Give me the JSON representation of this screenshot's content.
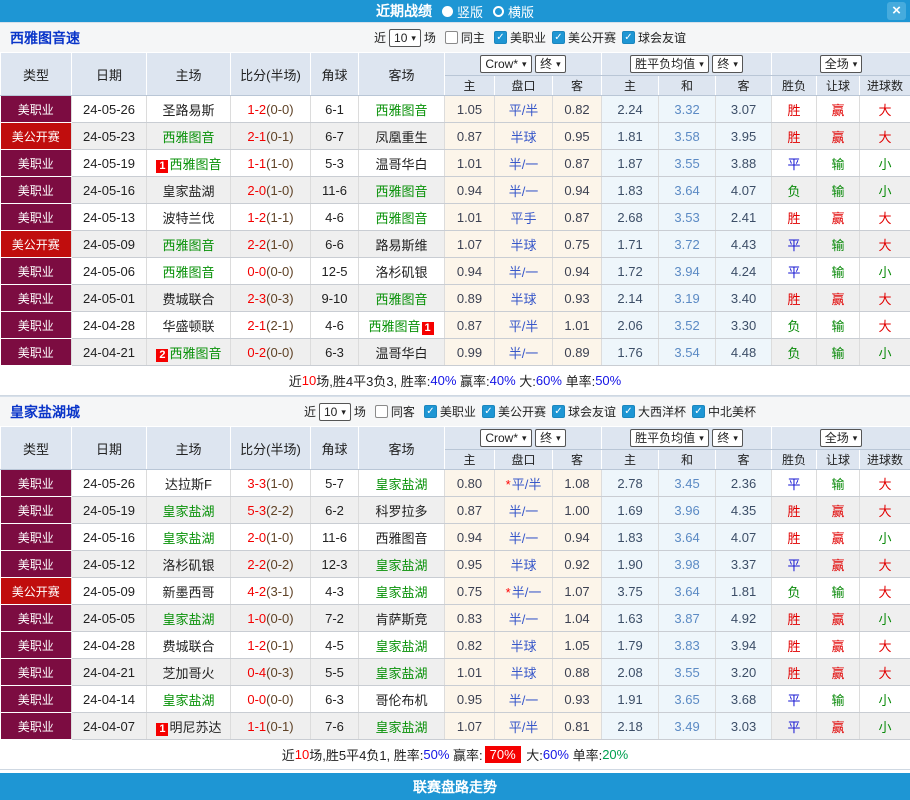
{
  "titlebar": {
    "title": "近期战绩",
    "vertical_label": "竖版",
    "horizontal_label": "横版",
    "close_glyph": "×"
  },
  "footer": {
    "label": "联赛盘路走势"
  },
  "icons": {
    "check": "✓",
    "caret": "▾",
    "star": "*"
  },
  "headers": {
    "type": "类型",
    "date": "日期",
    "home": "主场",
    "score": "比分(半场)",
    "corner": "角球",
    "away": "客场",
    "company_select": "Crow*",
    "final_select": "终",
    "avg_select": "胜平负均值",
    "final_select2": "终",
    "full_select": "全场",
    "sub": [
      "主",
      "盘口",
      "客",
      "主",
      "和",
      "客",
      "胜负",
      "让球",
      "进球数"
    ]
  },
  "league_colors": {
    "美职业": "#7c0c41",
    "美公开赛": "#c00d0d"
  },
  "result_colors": {
    "胜": "#e10000",
    "平": "#1414d2",
    "负": "#0a8a0a",
    "赢": "#e10000",
    "输": "#0a8a0a",
    "大": "#e10000",
    "小": "#0a8a0a"
  },
  "tables": [
    {
      "team": "西雅图音速",
      "filter": {
        "near": "近",
        "count": "10",
        "games": "场",
        "same": "同主",
        "same_checked": false,
        "leagues": [
          "美职业",
          "美公开赛",
          "球会友谊"
        ]
      },
      "rows": [
        {
          "league": "美职业",
          "date": "24-05-26",
          "home": {
            "name": "圣路易斯"
          },
          "score": {
            "full": "1-2",
            "half": "(0-0)"
          },
          "corner": "6-1",
          "away": {
            "name": "西雅图音",
            "green": true
          },
          "crow": [
            "1.05",
            "平/半",
            "0.82"
          ],
          "star": false,
          "avg": [
            "2.24",
            "3.32",
            "3.07"
          ],
          "result": [
            "胜",
            "赢",
            "大"
          ]
        },
        {
          "league": "美公开赛",
          "date": "24-05-23",
          "home": {
            "name": "西雅图音",
            "green": true
          },
          "score": {
            "full": "2-1",
            "half": "(0-1)"
          },
          "corner": "6-7",
          "away": {
            "name": "凤凰重生"
          },
          "crow": [
            "0.87",
            "半球",
            "0.95"
          ],
          "star": false,
          "avg": [
            "1.81",
            "3.58",
            "3.95"
          ],
          "result": [
            "胜",
            "赢",
            "大"
          ]
        },
        {
          "league": "美职业",
          "date": "24-05-19",
          "home": {
            "name": "西雅图音",
            "green": true,
            "badge": "1",
            "badge_pos": "before"
          },
          "score": {
            "full": "1-1",
            "half": "(1-0)"
          },
          "corner": "5-3",
          "away": {
            "name": "温哥华白"
          },
          "crow": [
            "1.01",
            "半/一",
            "0.87"
          ],
          "star": false,
          "avg": [
            "1.87",
            "3.55",
            "3.88"
          ],
          "result": [
            "平",
            "输",
            "小"
          ]
        },
        {
          "league": "美职业",
          "date": "24-05-16",
          "home": {
            "name": "皇家盐湖"
          },
          "score": {
            "full": "2-0",
            "half": "(1-0)"
          },
          "corner": "11-6",
          "away": {
            "name": "西雅图音",
            "green": true
          },
          "crow": [
            "0.94",
            "半/一",
            "0.94"
          ],
          "star": false,
          "avg": [
            "1.83",
            "3.64",
            "4.07"
          ],
          "result": [
            "负",
            "输",
            "小"
          ]
        },
        {
          "league": "美职业",
          "date": "24-05-13",
          "home": {
            "name": "波特兰伐"
          },
          "score": {
            "full": "1-2",
            "half": "(1-1)"
          },
          "corner": "4-6",
          "away": {
            "name": "西雅图音",
            "green": true
          },
          "crow": [
            "1.01",
            "平手",
            "0.87"
          ],
          "star": false,
          "avg": [
            "2.68",
            "3.53",
            "2.41"
          ],
          "result": [
            "胜",
            "赢",
            "大"
          ]
        },
        {
          "league": "美公开赛",
          "date": "24-05-09",
          "home": {
            "name": "西雅图音",
            "green": true
          },
          "score": {
            "full": "2-2",
            "half": "(1-0)"
          },
          "corner": "6-6",
          "away": {
            "name": "路易斯维"
          },
          "crow": [
            "1.07",
            "半球",
            "0.75"
          ],
          "star": false,
          "avg": [
            "1.71",
            "3.72",
            "4.43"
          ],
          "result": [
            "平",
            "输",
            "大"
          ]
        },
        {
          "league": "美职业",
          "date": "24-05-06",
          "home": {
            "name": "西雅图音",
            "green": true
          },
          "score": {
            "full": "0-0",
            "half": "(0-0)"
          },
          "corner": "12-5",
          "away": {
            "name": "洛杉矶银"
          },
          "crow": [
            "0.94",
            "半/一",
            "0.94"
          ],
          "star": false,
          "avg": [
            "1.72",
            "3.94",
            "4.24"
          ],
          "result": [
            "平",
            "输",
            "小"
          ]
        },
        {
          "league": "美职业",
          "date": "24-05-01",
          "home": {
            "name": "费城联合"
          },
          "score": {
            "full": "2-3",
            "half": "(0-3)"
          },
          "corner": "9-10",
          "away": {
            "name": "西雅图音",
            "green": true
          },
          "crow": [
            "0.89",
            "半球",
            "0.93"
          ],
          "star": false,
          "avg": [
            "2.14",
            "3.19",
            "3.40"
          ],
          "result": [
            "胜",
            "赢",
            "大"
          ]
        },
        {
          "league": "美职业",
          "date": "24-04-28",
          "home": {
            "name": "华盛顿联"
          },
          "score": {
            "full": "2-1",
            "half": "(2-1)"
          },
          "corner": "4-6",
          "away": {
            "name": "西雅图音",
            "green": true,
            "badge": "1",
            "badge_pos": "after"
          },
          "crow": [
            "0.87",
            "平/半",
            "1.01"
          ],
          "star": false,
          "avg": [
            "2.06",
            "3.52",
            "3.30"
          ],
          "result": [
            "负",
            "输",
            "大"
          ]
        },
        {
          "league": "美职业",
          "date": "24-04-21",
          "home": {
            "name": "西雅图音",
            "green": true,
            "badge": "2",
            "badge_pos": "before"
          },
          "score": {
            "full": "0-2",
            "half": "(0-0)"
          },
          "corner": "6-3",
          "away": {
            "name": "温哥华白"
          },
          "crow": [
            "0.99",
            "半/一",
            "0.89"
          ],
          "star": false,
          "avg": [
            "1.76",
            "3.54",
            "4.48"
          ],
          "result": [
            "负",
            "输",
            "小"
          ]
        }
      ],
      "summary": [
        {
          "t": "近",
          "c": "k"
        },
        {
          "t": "10",
          "c": "r"
        },
        {
          "t": "场,胜4平3负3, 胜率:",
          "c": "k"
        },
        {
          "t": "40%",
          "c": "b"
        },
        {
          "t": " 赢率:",
          "c": "k"
        },
        {
          "t": "40%",
          "c": "b"
        },
        {
          "t": " 大:",
          "c": "k"
        },
        {
          "t": "60%",
          "c": "b"
        },
        {
          "t": " 单率:",
          "c": "k"
        },
        {
          "t": "50%",
          "c": "b"
        }
      ]
    },
    {
      "team": "皇家盐湖城",
      "filter": {
        "near": "近",
        "count": "10",
        "games": "场",
        "same": "同客",
        "same_checked": false,
        "leagues": [
          "美职业",
          "美公开赛",
          "球会友谊",
          "大西洋杯",
          "中北美杯"
        ]
      },
      "rows": [
        {
          "league": "美职业",
          "date": "24-05-26",
          "home": {
            "name": "达拉斯F"
          },
          "score": {
            "full": "3-3",
            "half": "(1-0)"
          },
          "corner": "5-7",
          "away": {
            "name": "皇家盐湖",
            "green": true
          },
          "crow": [
            "0.80",
            "平/半",
            "1.08"
          ],
          "star": true,
          "avg": [
            "2.78",
            "3.45",
            "2.36"
          ],
          "result": [
            "平",
            "输",
            "大"
          ]
        },
        {
          "league": "美职业",
          "date": "24-05-19",
          "home": {
            "name": "皇家盐湖",
            "green": true
          },
          "score": {
            "full": "5-3",
            "half": "(2-2)"
          },
          "corner": "6-2",
          "away": {
            "name": "科罗拉多"
          },
          "crow": [
            "0.87",
            "半/一",
            "1.00"
          ],
          "star": false,
          "avg": [
            "1.69",
            "3.96",
            "4.35"
          ],
          "result": [
            "胜",
            "赢",
            "大"
          ]
        },
        {
          "league": "美职业",
          "date": "24-05-16",
          "home": {
            "name": "皇家盐湖",
            "green": true
          },
          "score": {
            "full": "2-0",
            "half": "(1-0)"
          },
          "corner": "11-6",
          "away": {
            "name": "西雅图音"
          },
          "crow": [
            "0.94",
            "半/一",
            "0.94"
          ],
          "star": false,
          "avg": [
            "1.83",
            "3.64",
            "4.07"
          ],
          "result": [
            "胜",
            "赢",
            "小"
          ]
        },
        {
          "league": "美职业",
          "date": "24-05-12",
          "home": {
            "name": "洛杉矶银"
          },
          "score": {
            "full": "2-2",
            "half": "(0-2)"
          },
          "corner": "12-3",
          "away": {
            "name": "皇家盐湖",
            "green": true
          },
          "crow": [
            "0.95",
            "半球",
            "0.92"
          ],
          "star": false,
          "avg": [
            "1.90",
            "3.98",
            "3.37"
          ],
          "result": [
            "平",
            "赢",
            "大"
          ]
        },
        {
          "league": "美公开赛",
          "date": "24-05-09",
          "home": {
            "name": "新墨西哥"
          },
          "score": {
            "full": "4-2",
            "half": "(3-1)"
          },
          "corner": "4-3",
          "away": {
            "name": "皇家盐湖",
            "green": true
          },
          "crow": [
            "0.75",
            "半/一",
            "1.07"
          ],
          "star": true,
          "avg": [
            "3.75",
            "3.64",
            "1.81"
          ],
          "result": [
            "负",
            "输",
            "大"
          ]
        },
        {
          "league": "美职业",
          "date": "24-05-05",
          "home": {
            "name": "皇家盐湖",
            "green": true
          },
          "score": {
            "full": "1-0",
            "half": "(0-0)"
          },
          "corner": "7-2",
          "away": {
            "name": "肯萨斯竞"
          },
          "crow": [
            "0.83",
            "半/一",
            "1.04"
          ],
          "star": false,
          "avg": [
            "1.63",
            "3.87",
            "4.92"
          ],
          "result": [
            "胜",
            "赢",
            "小"
          ]
        },
        {
          "league": "美职业",
          "date": "24-04-28",
          "home": {
            "name": "费城联合"
          },
          "score": {
            "full": "1-2",
            "half": "(0-1)"
          },
          "corner": "4-5",
          "away": {
            "name": "皇家盐湖",
            "green": true
          },
          "crow": [
            "0.82",
            "半球",
            "1.05"
          ],
          "star": false,
          "avg": [
            "1.79",
            "3.83",
            "3.94"
          ],
          "result": [
            "胜",
            "赢",
            "大"
          ]
        },
        {
          "league": "美职业",
          "date": "24-04-21",
          "home": {
            "name": "芝加哥火"
          },
          "score": {
            "full": "0-4",
            "half": "(0-3)"
          },
          "corner": "5-5",
          "away": {
            "name": "皇家盐湖",
            "green": true
          },
          "crow": [
            "1.01",
            "半球",
            "0.88"
          ],
          "star": false,
          "avg": [
            "2.08",
            "3.55",
            "3.20"
          ],
          "result": [
            "胜",
            "赢",
            "大"
          ]
        },
        {
          "league": "美职业",
          "date": "24-04-14",
          "home": {
            "name": "皇家盐湖",
            "green": true
          },
          "score": {
            "full": "0-0",
            "half": "(0-0)"
          },
          "corner": "6-3",
          "away": {
            "name": "哥伦布机"
          },
          "crow": [
            "0.95",
            "半/一",
            "0.93"
          ],
          "star": false,
          "avg": [
            "1.91",
            "3.65",
            "3.68"
          ],
          "result": [
            "平",
            "输",
            "小"
          ]
        },
        {
          "league": "美职业",
          "date": "24-04-07",
          "home": {
            "name": "明尼苏达",
            "badge": "1",
            "badge_pos": "before"
          },
          "score": {
            "full": "1-1",
            "half": "(0-1)"
          },
          "corner": "7-6",
          "away": {
            "name": "皇家盐湖",
            "green": true
          },
          "crow": [
            "1.07",
            "平/半",
            "0.81"
          ],
          "star": false,
          "avg": [
            "2.18",
            "3.49",
            "3.03"
          ],
          "result": [
            "平",
            "赢",
            "小"
          ]
        }
      ],
      "summary": [
        {
          "t": "近",
          "c": "k"
        },
        {
          "t": "10",
          "c": "r"
        },
        {
          "t": "场,胜5平4负1, 胜率:",
          "c": "k"
        },
        {
          "t": "50%",
          "c": "b"
        },
        {
          "t": " 赢率:",
          "c": "k"
        },
        {
          "t": "70%",
          "c": "hl"
        },
        {
          "t": " 大:",
          "c": "k"
        },
        {
          "t": "60%",
          "c": "b"
        },
        {
          "t": " 单率:",
          "c": "k"
        },
        {
          "t": "20%",
          "c": "g"
        }
      ]
    }
  ]
}
